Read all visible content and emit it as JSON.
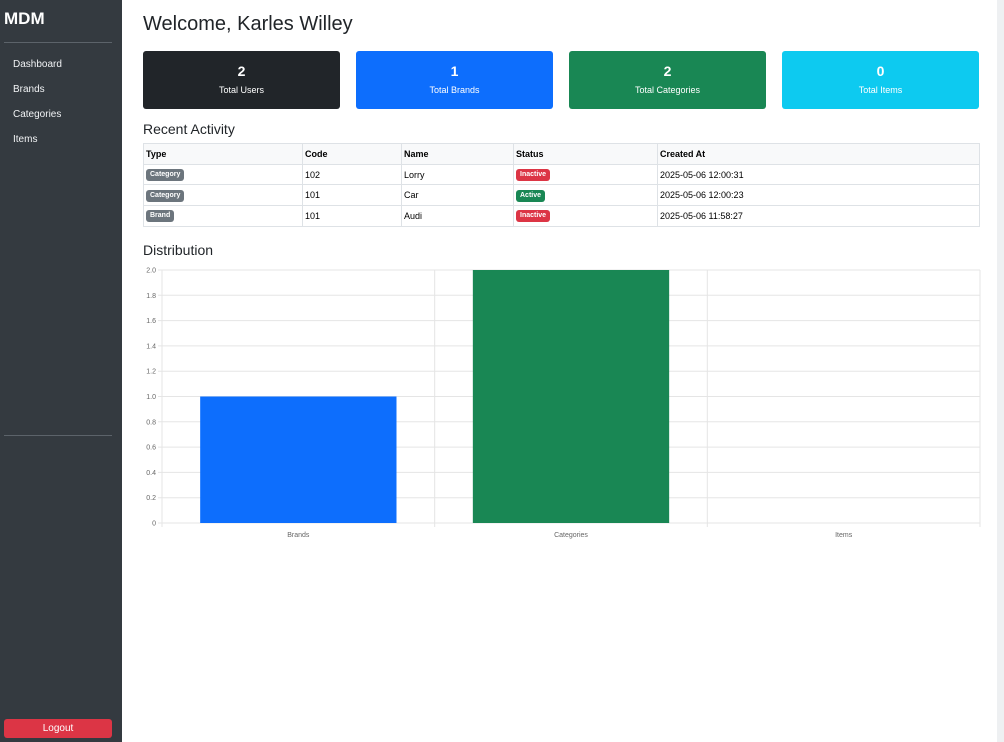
{
  "sidebar": {
    "brand": "MDM",
    "nav": [
      {
        "label": "Dashboard"
      },
      {
        "label": "Brands"
      },
      {
        "label": "Categories"
      },
      {
        "label": "Items"
      }
    ],
    "logout_label": "Logout"
  },
  "header": {
    "welcome": "Welcome, Karles Willey"
  },
  "cards": [
    {
      "value": "2",
      "label": "Total Users",
      "color": "#212529"
    },
    {
      "value": "1",
      "label": "Total Brands",
      "color": "#0d6efd"
    },
    {
      "value": "2",
      "label": "Total Categories",
      "color": "#198754"
    },
    {
      "value": "0",
      "label": "Total Items",
      "color": "#0dcaf0"
    }
  ],
  "activity": {
    "title": "Recent Activity",
    "headers": [
      "Type",
      "Code",
      "Name",
      "Status",
      "Created At"
    ],
    "rows": [
      {
        "type": "Category",
        "code": "102",
        "name": "Lorry",
        "status": "Inactive",
        "created": "2025-05-06 12:00:31"
      },
      {
        "type": "Category",
        "code": "101",
        "name": "Car",
        "status": "Active",
        "created": "2025-05-06 12:00:23"
      },
      {
        "type": "Brand",
        "code": "101",
        "name": "Audi",
        "status": "Inactive",
        "created": "2025-05-06 11:58:27"
      }
    ]
  },
  "colors": {
    "badge_type": "#6c757d",
    "active": "#198754",
    "inactive": "#dc3545"
  },
  "distribution": {
    "title": "Distribution"
  },
  "chart_data": {
    "type": "bar",
    "categories": [
      "Brands",
      "Categories",
      "Items"
    ],
    "values": [
      1,
      2,
      0
    ],
    "colors": [
      "#0d6efd",
      "#198754",
      "#0dcaf0"
    ],
    "ylim": [
      0,
      2
    ],
    "yticks": [
      0,
      0.2,
      0.4,
      0.6,
      0.8,
      1.0,
      1.2,
      1.4,
      1.6,
      1.8,
      2.0
    ],
    "ytick_labels": [
      "0",
      "0.2",
      "0.4",
      "0.6",
      "0.8",
      "1.0",
      "1.2",
      "1.4",
      "1.6",
      "1.8",
      "2.0"
    ],
    "grid": true,
    "legend": false
  }
}
